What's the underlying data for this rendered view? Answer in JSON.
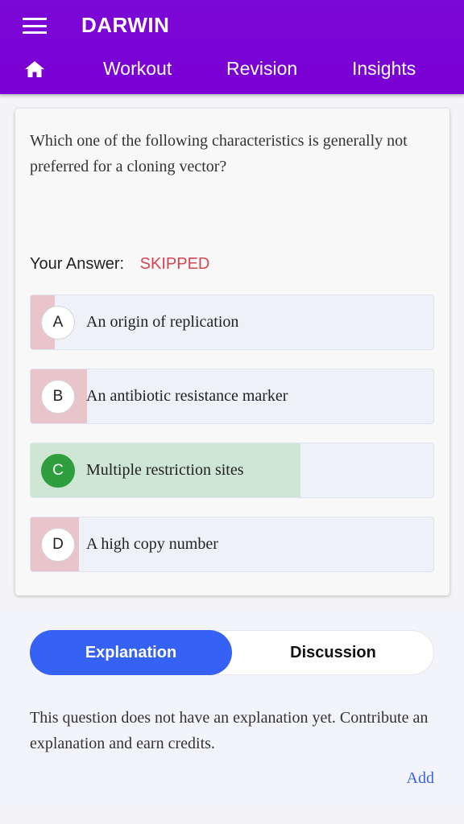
{
  "header": {
    "title": "DARWIN",
    "menu_icon": "hamburger-menu-icon",
    "home_icon": "home-icon",
    "nav": [
      "Workout",
      "Revision",
      "Insights"
    ],
    "color": "#7a00d4"
  },
  "question": {
    "text": "Which one of the following characteristics is generally not preferred for a cloning vector?",
    "your_answer_label": "Your Answer:",
    "your_answer_value": "SKIPPED",
    "options": [
      {
        "letter": "A",
        "text": "An origin of replication",
        "status": "wrong",
        "response_share": 0.06
      },
      {
        "letter": "B",
        "text": "An antibiotic resistance marker",
        "status": "wrong",
        "response_share": 0.14
      },
      {
        "letter": "C",
        "text": "Multiple restriction sites",
        "status": "correct",
        "response_share": 0.67
      },
      {
        "letter": "D",
        "text": "A high copy number",
        "status": "wrong",
        "response_share": 0.12
      }
    ]
  },
  "tabs": {
    "explanation": "Explanation",
    "discussion": "Discussion",
    "active": "explanation"
  },
  "explanation": {
    "text": "This question does not have an explanation yet. Contribute an explanation and earn credits.",
    "add_label": "Add"
  },
  "colors": {
    "primary": "#3562f5",
    "skipped": "#d6454f",
    "correct": "#2e9e3e",
    "wrong_fill": "#e9c4cb",
    "correct_fill": "#cfe6d4"
  }
}
